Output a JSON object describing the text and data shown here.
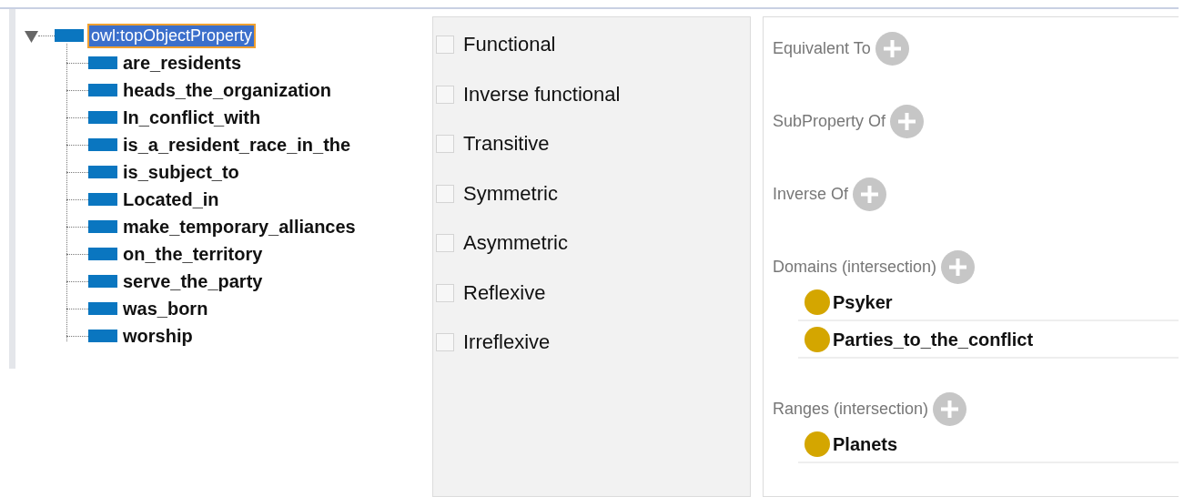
{
  "tree": {
    "label": "owl:topObjectProperty",
    "selected": true,
    "expanded": true,
    "children": [
      {
        "label": "are_residents",
        "selected": false
      },
      {
        "label": "heads_the_organization",
        "selected": false
      },
      {
        "label": "In_conflict_with",
        "selected": false
      },
      {
        "label": "is_a_resident_race_in_the",
        "selected": false
      },
      {
        "label": "is_subject_to",
        "selected": false
      },
      {
        "label": "Located_in",
        "selected": false
      },
      {
        "label": "make_temporary_alliances",
        "selected": false
      },
      {
        "label": "on_the_territory",
        "selected": false
      },
      {
        "label": "serve_the_party",
        "selected": false
      },
      {
        "label": "was_born",
        "selected": false
      },
      {
        "label": "worship",
        "selected": false
      }
    ]
  },
  "characteristics": [
    {
      "label": "Functional",
      "checked": false
    },
    {
      "label": "Inverse functional",
      "checked": false
    },
    {
      "label": "Transitive",
      "checked": false
    },
    {
      "label": "Symmetric",
      "checked": false
    },
    {
      "label": "Asymmetric",
      "checked": false
    },
    {
      "label": "Reflexive",
      "checked": false
    },
    {
      "label": "Irreflexive",
      "checked": false
    }
  ],
  "description": [
    {
      "title": "Equivalent To"
    },
    {
      "title": "SubProperty Of"
    },
    {
      "title": "Inverse Of"
    },
    {
      "title": "Domains (intersection)",
      "items": [
        {
          "label": "Psyker"
        },
        {
          "label": "Parties_to_the_conflict"
        }
      ]
    },
    {
      "title": "Ranges (intersection)",
      "items": [
        {
          "label": "Planets"
        }
      ]
    }
  ]
}
